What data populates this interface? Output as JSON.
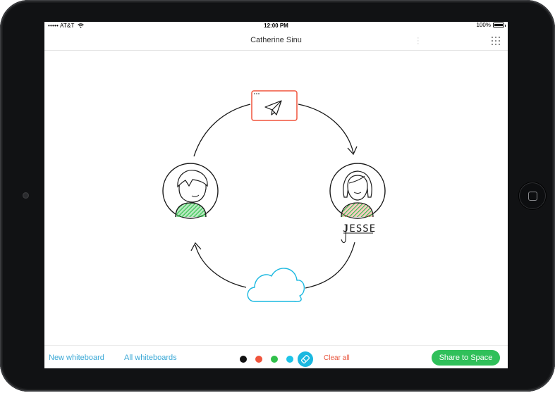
{
  "status_bar": {
    "carrier": "••••• AT&T",
    "time": "12:00 PM",
    "battery": "100%"
  },
  "header": {
    "title": "Catherine Sinu"
  },
  "whiteboard": {
    "signature_text": "JESSE",
    "icons": [
      "paper-plane-icon",
      "person-left-icon",
      "person-right-icon",
      "cloud-icon"
    ]
  },
  "toolbar": {
    "new_whiteboard": "New whiteboard",
    "all_whiteboards": "All whiteboards",
    "clear_all": "Clear all",
    "share_label": "Share to Space",
    "colors": [
      {
        "name": "black",
        "hex": "#111111"
      },
      {
        "name": "red",
        "hex": "#f0543c"
      },
      {
        "name": "green",
        "hex": "#30c04a"
      },
      {
        "name": "blue",
        "hex": "#1ec4e8"
      }
    ],
    "eraser_color": "#1ab8e0",
    "share_color": "#30c05a"
  }
}
